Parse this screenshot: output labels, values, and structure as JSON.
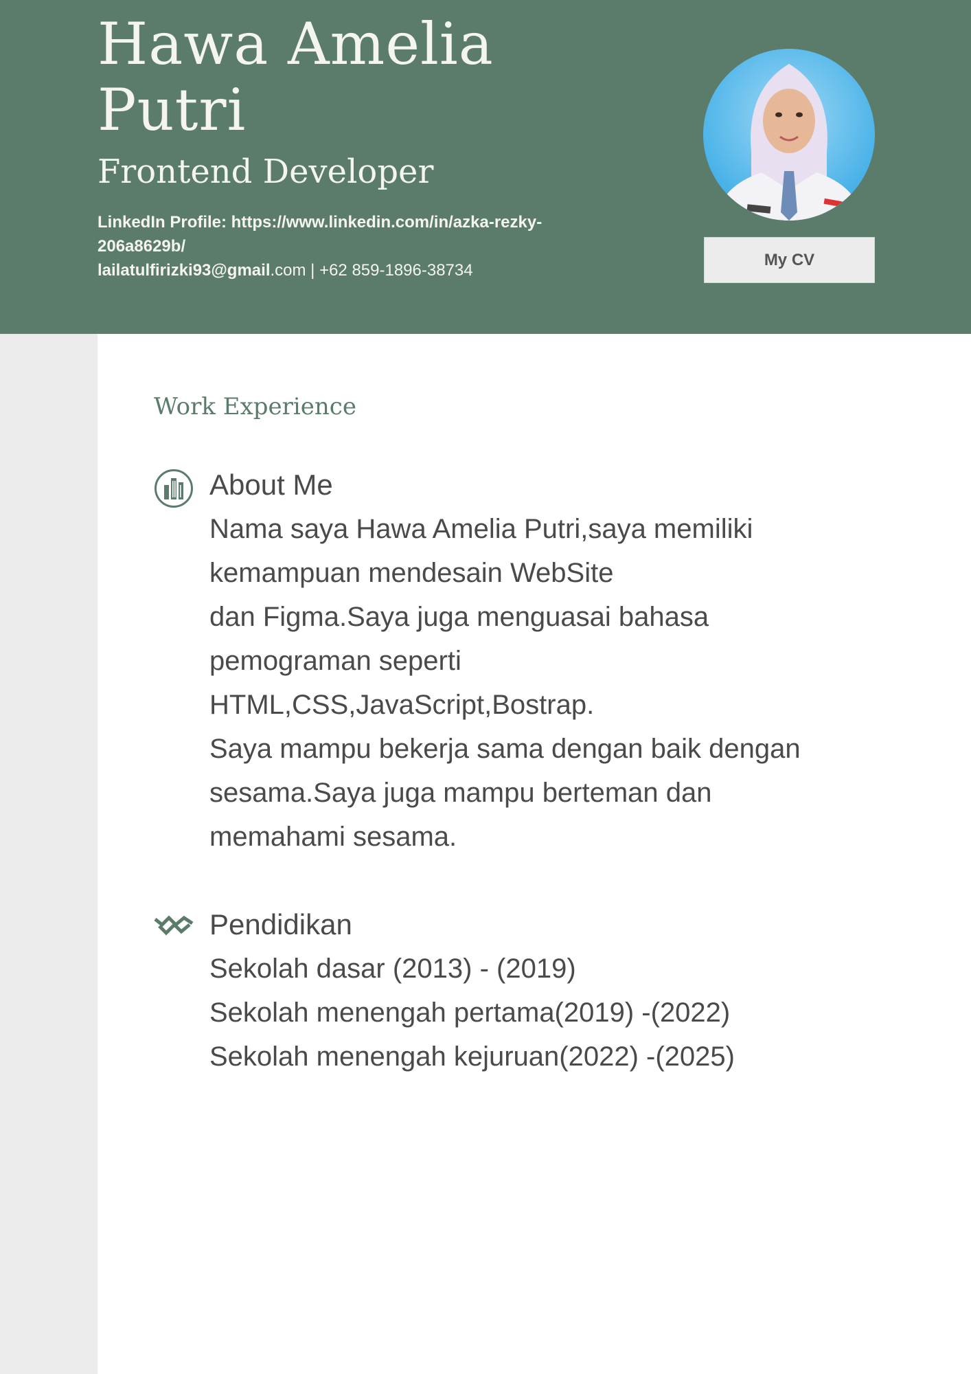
{
  "header": {
    "name_line1": "Hawa Amelia",
    "name_line2": "Putri",
    "role": "Frontend Developer",
    "linkedin_line1": "LinkedIn Profile: https://www.linkedin.com/in/azka-rezky-",
    "linkedin_line2": "206a8629b/",
    "email_bold": "lailatulfirizki93@gmail",
    "email_rest": ".com | +62 859-1896-38734",
    "cv_button": "My CV"
  },
  "main": {
    "section_title": "Work Experience",
    "about": {
      "heading": "About Me",
      "lines": [
        "Nama saya Hawa Amelia Putri,saya memiliki",
        "kemampuan mendesain WebSite",
        "dan Figma.Saya juga menguasai bahasa",
        "pemograman seperti",
        "HTML,CSS,JavaScript,Bostrap.",
        "Saya mampu bekerja sama dengan baik dengan",
        "sesama.Saya juga mampu berteman dan",
        "memahami sesama."
      ]
    },
    "education": {
      "heading": "Pendidikan",
      "lines": [
        "Sekolah dasar (2013) - (2019)",
        "Sekolah menengah pertama(2019) -(2022)",
        "Sekolah menengah kejuruan(2022) -(2025)"
      ]
    }
  },
  "colors": {
    "accent": "#5b7b6b",
    "sidebar": "#ececec",
    "text": "#4a4a4a"
  },
  "icons": {
    "about": "buildings-icon",
    "education": "chevrons-zigzag-icon"
  }
}
